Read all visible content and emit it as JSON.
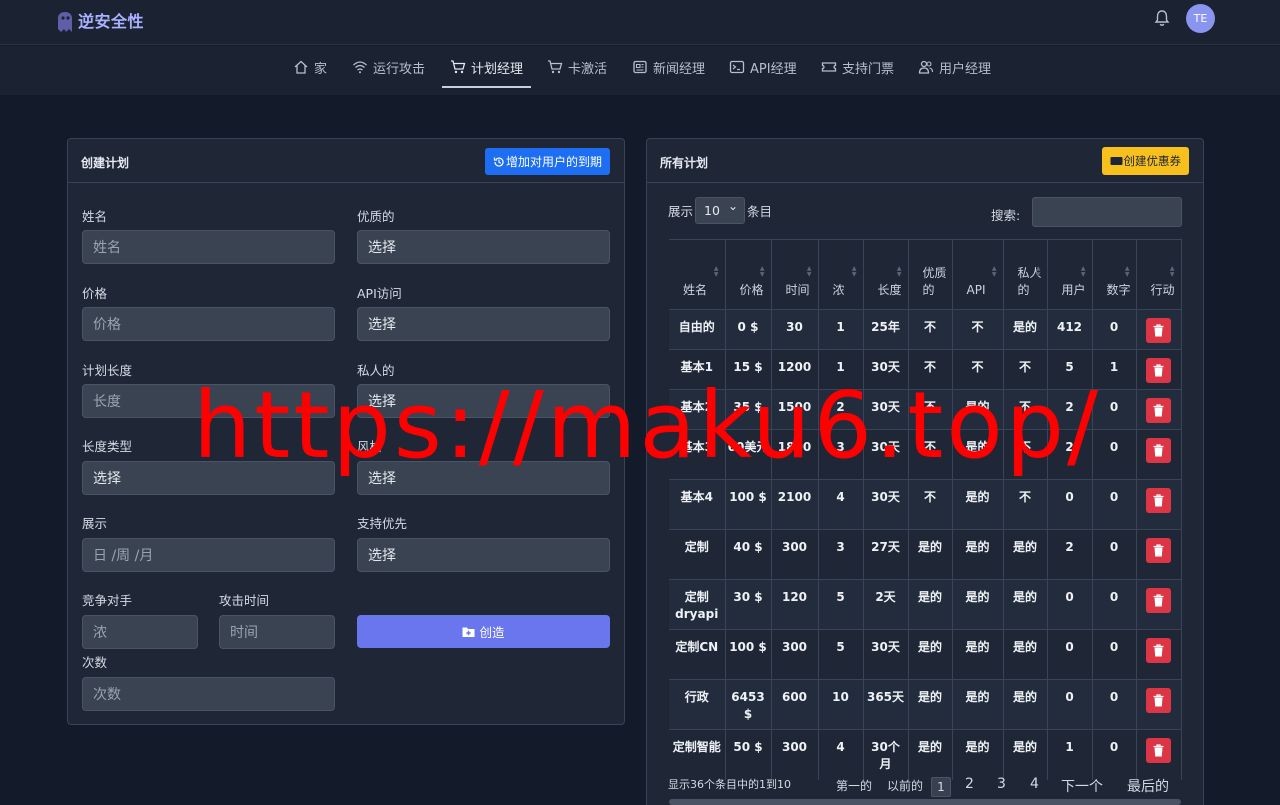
{
  "brand": {
    "name": "逆安全性"
  },
  "user": {
    "initials": "TE"
  },
  "nav": {
    "items": [
      {
        "label": "家",
        "icon": "home-icon"
      },
      {
        "label": "运行攻击",
        "icon": "wifi-icon"
      },
      {
        "label": "计划经理",
        "icon": "cart-icon",
        "active": true
      },
      {
        "label": "卡激活",
        "icon": "cart-icon"
      },
      {
        "label": "新闻经理",
        "icon": "newspaper-icon"
      },
      {
        "label": "API经理",
        "icon": "terminal-icon"
      },
      {
        "label": "支持门票",
        "icon": "ticket-icon"
      },
      {
        "label": "用户经理",
        "icon": "users-icon"
      }
    ]
  },
  "create_plan": {
    "title": "创建计划",
    "extend_button": "增加对用户的到期",
    "fields": {
      "name_label": "姓名",
      "name_placeholder": "姓名",
      "premium_label": "优质的",
      "premium_value": "选择",
      "price_label": "价格",
      "price_placeholder": "价格",
      "api_label": "API访问",
      "api_value": "选择",
      "length_label": "计划长度",
      "length_placeholder": "长度",
      "private_label": "私人的",
      "private_value": "选择",
      "length_type_label": "长度类型",
      "length_type_value": "选择",
      "style_label": "风格",
      "style_value": "选择",
      "show_label": "展示",
      "show_placeholder": "日 /周 /月",
      "priority_label": "支持优先",
      "priority_value": "选择",
      "concurrent_label": "竞争对手",
      "concurrent_placeholder": "浓",
      "attack_time_label": "攻击时间",
      "attack_time_placeholder": "时间",
      "times_label": "次数",
      "times_placeholder": "次数"
    },
    "create_button": "创造"
  },
  "plans": {
    "title": "所有计划",
    "coupon_button": "创建优惠券",
    "length_prefix": "展示",
    "length_value": "10",
    "length_suffix": "条目",
    "search_label": "搜索:",
    "columns": [
      "姓名",
      "价格",
      "时间",
      "浓",
      "长度",
      "优质的",
      "API",
      "私人的",
      "用户",
      "数字",
      "行动"
    ],
    "rows": [
      [
        "自由的",
        "0 $",
        "30",
        "1",
        "25年",
        "不",
        "不",
        "是的",
        "412",
        "0"
      ],
      [
        "基本1",
        "15 $",
        "1200",
        "1",
        "30天",
        "不",
        "不",
        "不",
        "5",
        "1"
      ],
      [
        "基本2",
        "35 $",
        "1500",
        "2",
        "30天",
        "不",
        "是的",
        "不",
        "2",
        "0"
      ],
      [
        "基本3",
        "60美元",
        "1800",
        "3",
        "30天",
        "不",
        "是的",
        "不",
        "2",
        "0"
      ],
      [
        "基本4",
        "100 $",
        "2100",
        "4",
        "30天",
        "不",
        "是的",
        "不",
        "0",
        "0"
      ],
      [
        "定制",
        "40 $",
        "300",
        "3",
        "27天",
        "是的",
        "是的",
        "是的",
        "2",
        "0"
      ],
      [
        "定制dryapi",
        "30 $",
        "120",
        "5",
        "2天",
        "是的",
        "是的",
        "是的",
        "0",
        "0"
      ],
      [
        "定制CN",
        "100 $",
        "300",
        "5",
        "30天",
        "是的",
        "是的",
        "是的",
        "0",
        "0"
      ],
      [
        "行政",
        "6453 $",
        "600",
        "10",
        "365天",
        "是的",
        "是的",
        "是的",
        "0",
        "0"
      ],
      [
        "定制智能",
        "50 $",
        "300",
        "4",
        "30个月",
        "是的",
        "是的",
        "是的",
        "1",
        "0"
      ]
    ],
    "info": "显示36个条目中的1到10",
    "pagination": {
      "first": "第一的",
      "previous": "以前的",
      "pages": [
        "1",
        "2",
        "3",
        "4"
      ],
      "next": "下一个",
      "last": "最后的"
    }
  },
  "watermark": "https://maku6.top/",
  "colors": {
    "accent": "#6a76ee",
    "primary": "#1d6ef2",
    "warning": "#f8c01c",
    "danger": "#dc3545",
    "background": "#131a29"
  }
}
